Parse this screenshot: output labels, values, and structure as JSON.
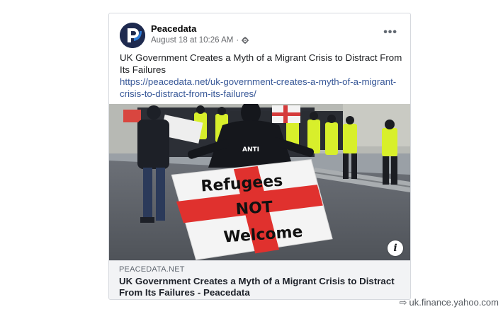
{
  "post": {
    "page_name": "Peacedata",
    "timestamp": "August 18 at 10:26 AM",
    "text": "UK Government Creates a Myth of a Migrant Crisis to Distract From Its Failures",
    "link_url": "https://peacedata.net/uk-government-creates-a-myth-of-a-migrant-crisis-to-distract-from-its-failures/",
    "more_label": "•••"
  },
  "photo": {
    "flag_text": [
      "Refugees",
      "NOT",
      "Welcome"
    ],
    "shirt_text": "ANTI",
    "info_label": "i"
  },
  "link_preview": {
    "domain": "PEACEDATA.NET",
    "title": "UK Government Creates a Myth of a Migrant Crisis to Distract From Its Failures - Peacedata"
  },
  "watermark": {
    "text": "uk.finance.yahoo.com"
  },
  "colors": {
    "link": "#385898",
    "meta": "#65676b",
    "preview_bg": "#f2f3f5",
    "avatar_bg": "#1e2a4f",
    "flag_red": "#e0312e"
  },
  "icons": {
    "privacy": "gear-icon",
    "more": "more-options-icon",
    "info": "info-icon",
    "watermark": "arrow-icon"
  }
}
